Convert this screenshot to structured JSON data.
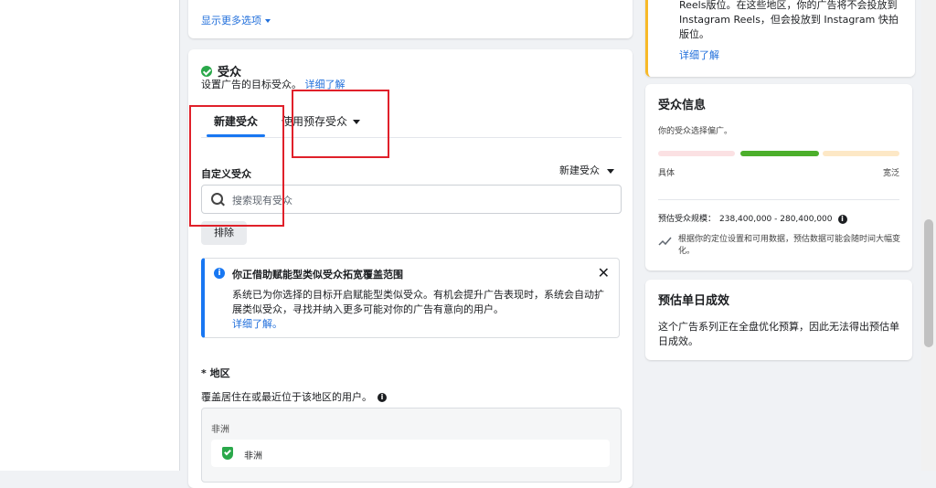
{
  "top_card": {
    "more_options": "显示更多选项"
  },
  "audience": {
    "title": "受众",
    "subtitle": "设置广告的目标受众。",
    "learn_more": "详细了解",
    "tabs": {
      "new": "新建受众",
      "saved": "使用预存受众"
    },
    "custom_audience_label": "自定义受众",
    "new_audience_dropdown": "新建受众",
    "search_placeholder": "搜索现有受众",
    "exclude_button": "排除",
    "notice": {
      "title": "你正借助赋能型类似受众拓宽覆盖范围",
      "body": "系统已为你选择的目标开启赋能型类似受众。有机会提升广告表现时，系统会自动扩展类似受众，寻找并纳入更多可能对你的广告有意向的用户。",
      "link": "详细了解。"
    },
    "location": {
      "label": "* 地区",
      "description": "覆盖居住在或最近位于该地区的用户。",
      "group": "非洲",
      "item": "非洲"
    }
  },
  "placement_card": {
    "text": "Reels版位。在这些地区，你的广告将不会投放到 Instagram Reels，但会投放到 Instagram 快拍版位。",
    "link": "详细了解"
  },
  "audience_info": {
    "title": "受众信息",
    "subtitle": "你的受众选择偏广。",
    "specific": "具体",
    "broad": "宽泛",
    "size_label": "预估受众规模：",
    "size_value": "238,400,000 - 280,400,000",
    "note": "根据你的定位设置和可用数据，预估数据可能会随时间大幅变化。"
  },
  "daily_results": {
    "title": "预估单日成效",
    "body": "这个广告系列正在全盘优化预算，因此无法得出预估单日成效。"
  },
  "colors": {
    "accent": "#1877f2",
    "link": "#216fdb",
    "success": "#2aa84a",
    "warning": "#f7b928",
    "annotation_red": "#e0202a"
  }
}
